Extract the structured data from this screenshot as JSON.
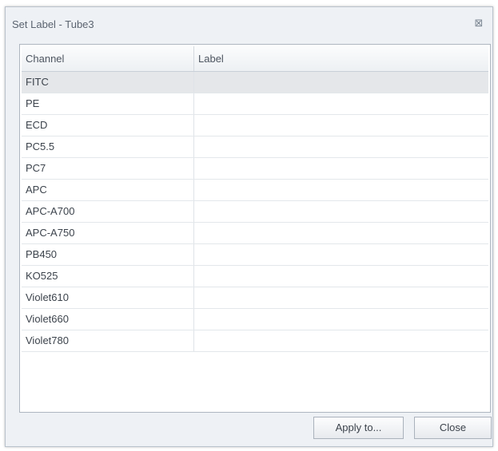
{
  "window": {
    "title": "Set Label - Tube3",
    "close_glyph": "⊠",
    "close_icon": "close-icon"
  },
  "grid": {
    "columns": [
      "Channel",
      "Label"
    ],
    "rows": [
      {
        "channel": "FITC",
        "label": "",
        "selected": true
      },
      {
        "channel": "PE",
        "label": ""
      },
      {
        "channel": "ECD",
        "label": ""
      },
      {
        "channel": "PC5.5",
        "label": ""
      },
      {
        "channel": "PC7",
        "label": ""
      },
      {
        "channel": "APC",
        "label": ""
      },
      {
        "channel": "APC-A700",
        "label": ""
      },
      {
        "channel": "APC-A750",
        "label": ""
      },
      {
        "channel": "PB450",
        "label": ""
      },
      {
        "channel": "KO525",
        "label": ""
      },
      {
        "channel": "Violet610",
        "label": ""
      },
      {
        "channel": "Violet660",
        "label": ""
      },
      {
        "channel": "Violet780",
        "label": ""
      }
    ]
  },
  "buttons": {
    "apply_label": "Apply to...",
    "close_label": "Close"
  },
  "colors": {
    "window_bg": "#eef1f5",
    "selected_row": "#e5e7ea",
    "border": "#aeb6c0"
  }
}
